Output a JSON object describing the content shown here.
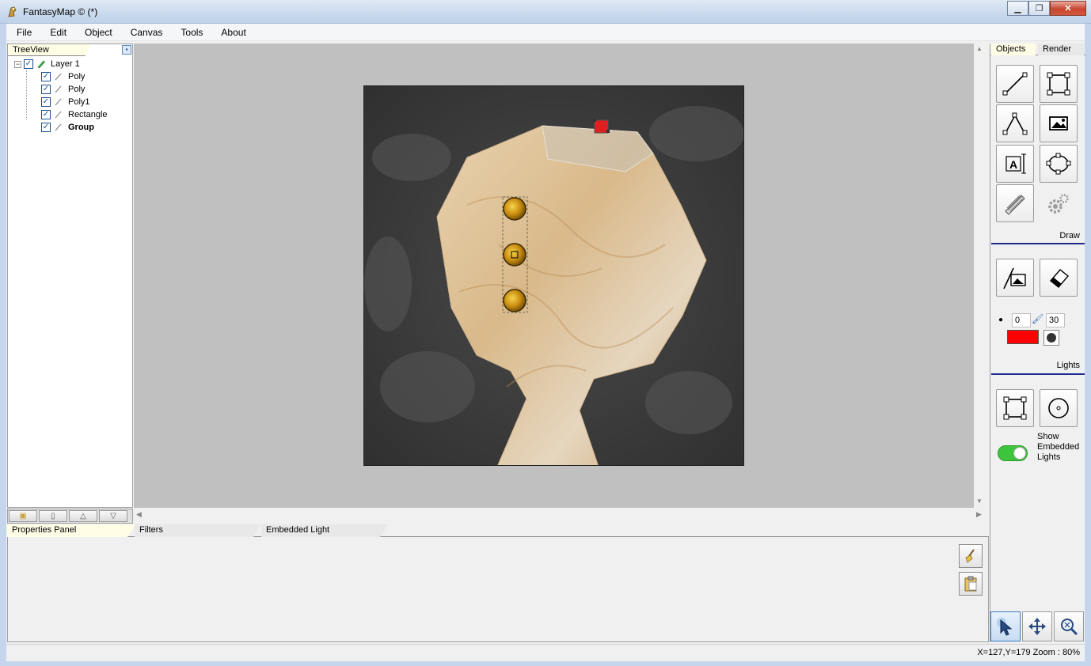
{
  "window": {
    "title": "FantasyMap © (*)"
  },
  "menu": [
    "File",
    "Edit",
    "Object",
    "Canvas",
    "Tools",
    "About"
  ],
  "treeview": {
    "tab_label": "TreeView",
    "root": {
      "label": "Layer 1",
      "checked": true
    },
    "children": [
      {
        "label": "Poly",
        "checked": true,
        "bold": false
      },
      {
        "label": "Poly",
        "checked": true,
        "bold": false
      },
      {
        "label": "Poly1",
        "checked": true,
        "bold": false
      },
      {
        "label": "Rectangle",
        "checked": true,
        "bold": false
      },
      {
        "label": "Group",
        "checked": true,
        "bold": true
      }
    ]
  },
  "bottom_tabs": [
    "Properties Panel",
    "Filters",
    "Embedded Light"
  ],
  "right_panel": {
    "tabs": [
      "Objects",
      "Render"
    ],
    "draw_label": "Draw",
    "lights_label": "Lights",
    "brush_size": "0",
    "brush_width": "30",
    "brush_color": "#ff0000",
    "show_embedded_lights": "Show Embedded Lights",
    "show_embedded_lights_on": true
  },
  "status": {
    "coords": "X=127,Y=179  Zoom : 80%"
  },
  "colors": {
    "accent": "#1e2a8c",
    "toggle_on": "#3dc63d",
    "canvas_bg": "#c0c0c0"
  }
}
